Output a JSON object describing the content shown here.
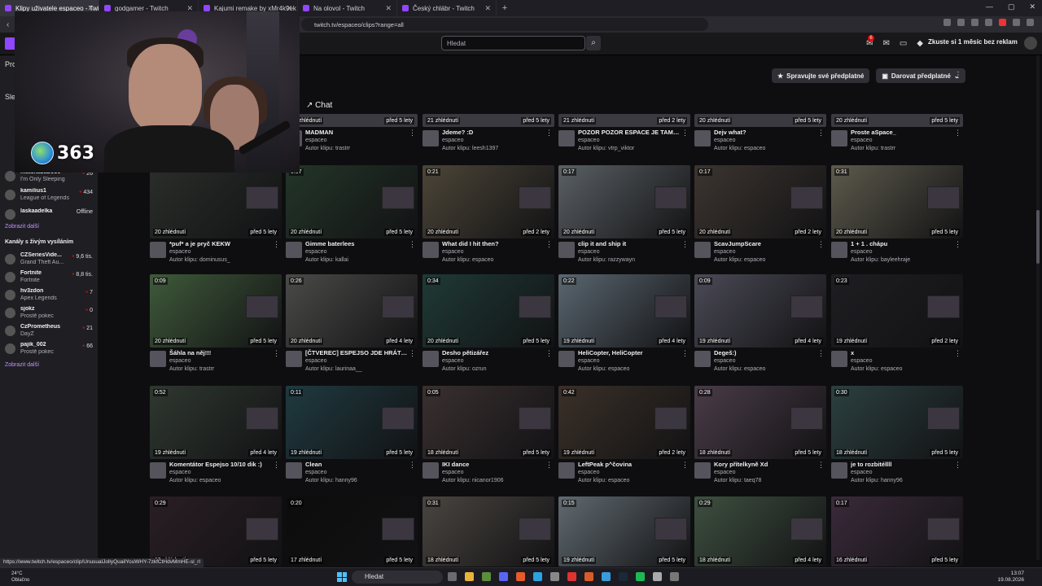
{
  "browser": {
    "tabs": [
      {
        "title": "Klipy uživatele espaceo - Twitch",
        "active": true
      },
      {
        "title": "godgamer - Twitch",
        "active": false
      },
      {
        "title": "Kajumi remake by xMr4k9ek - Twitch",
        "active": false
      },
      {
        "title": "Na olovol - Twitch",
        "active": false
      },
      {
        "title": "Český chlábr - Twitch",
        "active": false
      }
    ],
    "new_tab": "+",
    "url": "twitch.tv/espaceo/clips?range=all"
  },
  "topnav": {
    "search_placeholder": "Hledat",
    "notif_count": "6",
    "promo": "Zkuste si 1 měsíc bez reklam"
  },
  "sidebar": {
    "title": "Pro",
    "followed_partial": "Sled",
    "channels": [
      {
        "name": "matchababoo0",
        "game": "I'm Only Sleeping",
        "viewers": "26"
      },
      {
        "name": "kamilius1",
        "game": "League of Legends",
        "viewers": "434"
      },
      {
        "name": "laskaadelka",
        "game": "",
        "viewers": "Offline"
      }
    ],
    "show_more_1": "Zobrazit další",
    "live_label": "Kanály s živým vysíláním",
    "live_channels": [
      {
        "name": "CZSeriesVide...",
        "game": "Grand Theft Au...",
        "viewers": "9,6 tis."
      },
      {
        "name": "Fortnite",
        "game": "Fortnite",
        "viewers": "8,8 tis."
      },
      {
        "name": "hv3zdon",
        "game": "Apex Legends",
        "viewers": "7"
      },
      {
        "name": "sjokz",
        "game": "Prostě pokec",
        "viewers": "0"
      },
      {
        "name": "CzPrometheus",
        "game": "DayZ",
        "viewers": "21"
      },
      {
        "name": "pajik_002",
        "game": "Prostě pokec",
        "viewers": "66"
      }
    ],
    "show_more_2": "Zobrazit další"
  },
  "overlay": {
    "sub_count": "363"
  },
  "header": {
    "manage_subs": "Spravujte své předplatné",
    "gift_sub": "Darovat předplatné",
    "chat": "Chat"
  },
  "clips_top": [
    {
      "views": "20 zhlédnutí",
      "age": "před 5 lety",
      "title": "MADMAN",
      "channel": "espaceo",
      "author": "Autor klipu: trastrr"
    },
    {
      "views": "21 zhlédnutí",
      "age": "před 5 lety",
      "title": "Jdeme? :D",
      "channel": "espaceo",
      "author": "Autor klipu: leesh1397"
    },
    {
      "views": "21 zhlédnutí",
      "age": "před 2 lety",
      "title": "POZOR POZOR ESPACE JE TAM TY...",
      "channel": "espaceo",
      "author": "Autor klipu: vtrp_viktor"
    },
    {
      "views": "20 zhlédnutí",
      "age": "před 5 lety",
      "title": "Dejv what?",
      "channel": "espaceo",
      "author": "Autor klipu: espaceo"
    },
    {
      "views": "20 zhlédnutí",
      "age": "před 5 lety",
      "title": "Proste aSpace_",
      "channel": "espaceo",
      "author": "Autor klipu: trastrr"
    }
  ],
  "clips": [
    {
      "dur": "",
      "views": "20 zhlédnutí",
      "age": "před 5 lety",
      "title": "*puf* a je pryč KEKW",
      "channel": "espaceo",
      "author": "Autor klipu: dominusus_",
      "color": "#2a2e2a"
    },
    {
      "dur": "0:07",
      "views": "20 zhlédnutí",
      "age": "před 5 lety",
      "title": "Gimme baterlees",
      "channel": "espaceo",
      "author": "Autor klipu: kallai",
      "color": "#233528"
    },
    {
      "dur": "0:21",
      "views": "20 zhlédnutí",
      "age": "před 2 lety",
      "title": "What did I hit then?",
      "channel": "espaceo",
      "author": "Autor klipu: espaceo",
      "color": "#4c4538"
    },
    {
      "dur": "0:17",
      "views": "20 zhlédnutí",
      "age": "před 5 lety",
      "title": "clip it and ship it",
      "channel": "espaceo",
      "author": "Autor klipu: razzywayn",
      "color": "#5a6064"
    },
    {
      "dur": "0:17",
      "views": "20 zhlédnutí",
      "age": "před 2 lety",
      "title": "ScavJumpScare",
      "channel": "espaceo",
      "author": "Autor klipu: espaceo",
      "color": "#3c3530"
    },
    {
      "dur": "0:31",
      "views": "20 zhlédnutí",
      "age": "před 5 lety",
      "title": "1 + 1 . chápu",
      "channel": "espaceo",
      "author": "Autor klipu: bayleehraje",
      "color": "#5d5a4c"
    },
    {
      "dur": "0:09",
      "views": "20 zhlédnutí",
      "age": "před 5 lety",
      "title": "Šáhla na něj!!!",
      "channel": "espaceo",
      "author": "Autor klipu: trastrr",
      "color": "#3f5a3a"
    },
    {
      "dur": "0:26",
      "views": "20 zhlédnutí",
      "age": "před 4 lety",
      "title": "[ČTVEREC] ESPEJSO JDE HRÁT FIV...",
      "channel": "espaceo",
      "author": "Autor klipu: laurinaa__",
      "color": "#4a4a48"
    },
    {
      "dur": "0:34",
      "views": "20 zhlédnutí",
      "age": "před 5 lety",
      "title": "Desho pětizářez",
      "channel": "espaceo",
      "author": "Autor klipu: ozrun",
      "color": "#1f3a36"
    },
    {
      "dur": "0:22",
      "views": "19 zhlédnutí",
      "age": "před 4 lety",
      "title": "HeliCopter, HeliCopter",
      "channel": "espaceo",
      "author": "Autor klipu: espaceo",
      "color": "#5a6670"
    },
    {
      "dur": "0:09",
      "views": "19 zhlédnutí",
      "age": "před 4 lety",
      "title": "Degeš:)",
      "channel": "espaceo",
      "author": "Autor klipu: espaceo",
      "color": "#4b4a56"
    },
    {
      "dur": "0:23",
      "views": "19 zhlédnutí",
      "age": "před 2 lety",
      "title": "x",
      "channel": "espaceo",
      "author": "Autor klipu: espaceo",
      "color": "#1e1e22"
    },
    {
      "dur": "0:52",
      "views": "19 zhlédnutí",
      "age": "před 4 lety",
      "title": "Komentátor Espejso 10/10 dik :)",
      "channel": "espaceo",
      "author": "Autor klipu: espaceo",
      "color": "#2f3830"
    },
    {
      "dur": "0:11",
      "views": "19 zhlédnutí",
      "age": "před 5 lety",
      "title": "Clean",
      "channel": "espaceo",
      "author": "Autor klipu: hanny96",
      "color": "#1f3a40"
    },
    {
      "dur": "0:05",
      "views": "18 zhlédnutí",
      "age": "před 5 lety",
      "title": "IKI dance",
      "channel": "espaceo",
      "author": "Autor klipu: nicanor1906",
      "color": "#3a3030"
    },
    {
      "dur": "0:42",
      "views": "19 zhlédnutí",
      "age": "před 2 lety",
      "title": "LeftPeak p^čovina",
      "channel": "espaceo",
      "author": "Autor klipu: espaceo",
      "color": "#3a3028"
    },
    {
      "dur": "0:28",
      "views": "18 zhlédnutí",
      "age": "před 5 lety",
      "title": "Kory přítelkyně Xd",
      "channel": "espaceo",
      "author": "Autor klipu: taeq78",
      "color": "#4a3c48"
    },
    {
      "dur": "0:30",
      "views": "18 zhlédnutí",
      "age": "před 5 lety",
      "title": "je to rozbitéllll",
      "channel": "espaceo",
      "author": "Autor klipu: hanny96",
      "color": "#2c4040"
    },
    {
      "dur": "0:29",
      "views": "19 zhlédnutí",
      "age": "před 5 lety",
      "title": "",
      "channel": "",
      "author": "",
      "color": "#2a1e24"
    },
    {
      "dur": "0:20",
      "views": "17 zhlédnutí",
      "age": "před 5 lety",
      "title": "",
      "channel": "",
      "author": "",
      "color": "#0c0c0c"
    },
    {
      "dur": "0:31",
      "views": "18 zhlédnutí",
      "age": "před 5 lety",
      "title": "",
      "channel": "",
      "author": "",
      "color": "#4a4540"
    },
    {
      "dur": "0:15",
      "views": "19 zhlédnutí",
      "age": "před 5 lety",
      "title": "",
      "channel": "",
      "author": "",
      "color": "#606a70"
    },
    {
      "dur": "0:29",
      "views": "18 zhlédnutí",
      "age": "před 4 lety",
      "title": "",
      "channel": "",
      "author": "",
      "color": "#3e5040"
    },
    {
      "dur": "0:17",
      "views": "16 zhlédnutí",
      "age": "před 5 lety",
      "title": "",
      "channel": "",
      "author": "",
      "color": "#3a2a3a"
    }
  ],
  "status_url": "https://www.twitch.tv/espaceo/clip/UnusualJollyQuailYouWHY-7zkfCtHdvMmHE-sl_rl",
  "taskbar": {
    "temp": "24°C",
    "weather": "Oblačno",
    "search": "Hledat",
    "time": "13:07",
    "date": "19.08.2026"
  }
}
